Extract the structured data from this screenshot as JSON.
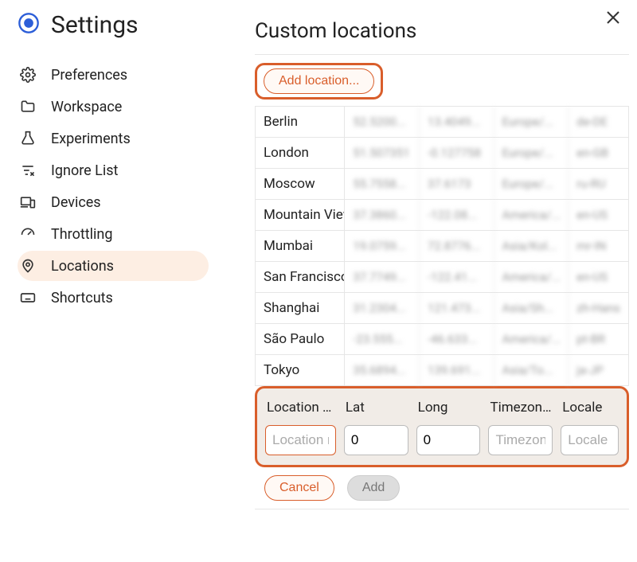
{
  "sidebar": {
    "title": "Settings",
    "items": [
      {
        "label": "Preferences"
      },
      {
        "label": "Workspace"
      },
      {
        "label": "Experiments"
      },
      {
        "label": "Ignore List"
      },
      {
        "label": "Devices"
      },
      {
        "label": "Throttling"
      },
      {
        "label": "Locations"
      },
      {
        "label": "Shortcuts"
      }
    ],
    "active_index": 6
  },
  "page": {
    "title": "Custom locations",
    "add_button": "Add location..."
  },
  "locations": [
    {
      "name": "Berlin",
      "lat": "52.5200...",
      "lng": "13.4049...",
      "tz": "Europe/...",
      "locale": "de-DE"
    },
    {
      "name": "London",
      "lat": "51.507351",
      "lng": "-0.127758",
      "tz": "Europe/...",
      "locale": "en-GB"
    },
    {
      "name": "Moscow",
      "lat": "55.7558...",
      "lng": "37.6173",
      "tz": "Europe/...",
      "locale": "ru-RU"
    },
    {
      "name": "Mountain View",
      "lat": "37.3860...",
      "lng": "-122.08...",
      "tz": "America/...",
      "locale": "en-US"
    },
    {
      "name": "Mumbai",
      "lat": "19.0759...",
      "lng": "72.8776...",
      "tz": "Asia/Kol...",
      "locale": "mr-IN"
    },
    {
      "name": "San Francisco",
      "lat": "37.7749...",
      "lng": "-122.41...",
      "tz": "America/...",
      "locale": "en-US"
    },
    {
      "name": "Shanghai",
      "lat": "31.2304...",
      "lng": "121.473...",
      "tz": "Asia/Sh...",
      "locale": "zh-Hans"
    },
    {
      "name": "São Paulo",
      "lat": "-23.555...",
      "lng": "-46.633...",
      "tz": "America/...",
      "locale": "pt-BR"
    },
    {
      "name": "Tokyo",
      "lat": "35.6894...",
      "lng": "139.691...",
      "tz": "Asia/To...",
      "locale": "ja-JP"
    }
  ],
  "form": {
    "headers": {
      "name": "Location name",
      "lat": "Lat",
      "lng": "Long",
      "tz": "Timezone ID",
      "locale": "Locale"
    },
    "placeholders": {
      "name": "Location name",
      "tz": "Timezone ID",
      "locale": "Locale"
    },
    "values": {
      "name": "",
      "lat": "0",
      "lng": "0",
      "tz": "",
      "locale": ""
    },
    "actions": {
      "cancel": "Cancel",
      "add": "Add"
    }
  }
}
